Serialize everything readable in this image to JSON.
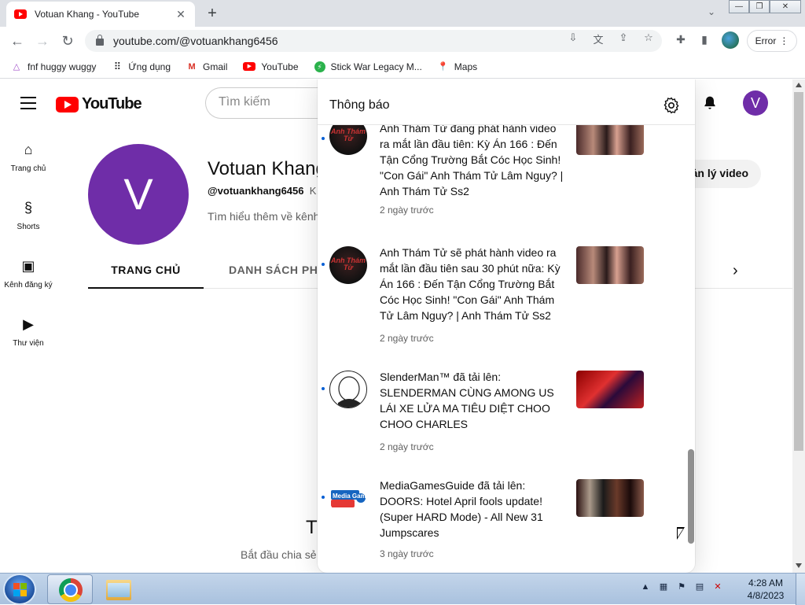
{
  "browser": {
    "tab_title": "Votuan Khang - YouTube",
    "tab_close": "✕",
    "new_tab": "+",
    "url": "youtube.com/@votuankhang6456",
    "error_label": "Error",
    "win_min": "—",
    "win_max": "❐",
    "win_close": "✕"
  },
  "bookmarks": [
    {
      "label": "fnf huggy wuggy",
      "icon": "triangle-icon"
    },
    {
      "label": "Ứng dụng",
      "icon": "apps-grid-icon"
    },
    {
      "label": "Gmail",
      "icon": "gmail-icon"
    },
    {
      "label": "YouTube",
      "icon": "youtube-icon"
    },
    {
      "label": "Stick War Legacy M...",
      "icon": "stickwar-icon"
    },
    {
      "label": "Maps",
      "icon": "maps-pin-icon"
    }
  ],
  "youtube": {
    "logo_text": "YouTube",
    "search_placeholder": "Tìm kiếm",
    "avatar_letter": "V",
    "guide": [
      {
        "label": "Trang chủ",
        "icon": "home-icon"
      },
      {
        "label": "Shorts",
        "icon": "shorts-icon"
      },
      {
        "label": "Kênh đăng ký",
        "icon": "subscriptions-icon"
      },
      {
        "label": "Thư viện",
        "icon": "library-icon"
      }
    ]
  },
  "channel": {
    "avatar_letter": "V",
    "name": "Votuan Khang",
    "handle": "@votuankhang6456",
    "handle_suffix": "K",
    "about": "Tìm hiểu thêm về kênh",
    "manage_button": "ản lý video",
    "tabs": [
      "TRANG CHỦ",
      "DANH SÁCH PHÁ"
    ],
    "empty_title": "T",
    "empty_subtitle": "Bắt đầu chia sẻ"
  },
  "notifications": {
    "title": "Thông báo",
    "items": [
      {
        "text": "Anh Thám Tử đang phát hành video ra mắt lần đầu tiên: Kỳ Án 166 : Đến Tận Cổng Trường Bắt Cóc Học Sinh! \"Con Gái\" Anh Thám Tử Lâm Nguy? | Anh Thám Tử Ss2",
        "time": "2 ngày trước",
        "avatar_text": "Anh Thám Tử"
      },
      {
        "text": "Anh Thám Tử sẽ phát hành video ra mắt lần đầu tiên sau 30 phút nữa: Kỳ Án 166 : Đến Tận Cổng Trường Bắt Cóc Học Sinh! \"Con Gái\" Anh Thám Tử Lâm Nguy? | Anh Thám Tử Ss2",
        "time": "2 ngày trước",
        "avatar_text": "Anh Thám Tử"
      },
      {
        "text": "SlenderMan™ đã tải lên: SLENDERMAN CÙNG AMONG US LÁI XE LỬA MA TIÊU DIỆT CHOO CHOO CHARLES",
        "time": "2 ngày trước",
        "avatar_text": ""
      },
      {
        "text": "MediaGamesGuide đã tải lên: DOORS: Hotel April fools update! (Super HARD Mode) - All New 31 Jumpscares",
        "time": "3 ngày trước",
        "avatar_text": "Media Games"
      }
    ]
  },
  "taskbar": {
    "time": "4:28 AM",
    "date": "4/8/2023"
  },
  "colors": {
    "youtube_red": "#ff0000",
    "avatar_purple": "#6f2da8",
    "unread_dot": "#065fd4"
  }
}
